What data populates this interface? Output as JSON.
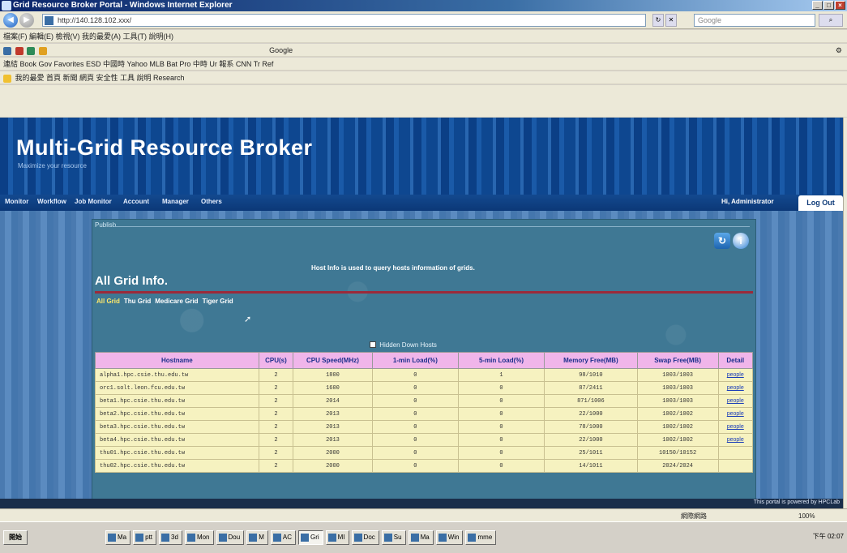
{
  "window": {
    "title": "Grid Resource Broker Portal - Windows Internet Explorer",
    "address": "http://140.128.102.xxx/",
    "search_placeholder": "Google"
  },
  "toolbars": {
    "menu_row": "檔案(F)  編輯(E)  檢視(V)  我的最愛(A)  工具(T)  說明(H)",
    "google_row": "Google",
    "links_row": "連結  Book  Gov  Favorites  ESD  中國時  Yahoo  MLB  Bat  Pro  中時  Ur  報系  CNN  Tr  Ref",
    "fav_row": "我的最愛  首頁  新聞  網頁  安全性  工具  說明  Research"
  },
  "header": {
    "title": "Multi-Grid Resource Broker",
    "subtitle": "Maximize your resource"
  },
  "nav": {
    "items": [
      "Monitor",
      "Workflow",
      "Job Monitor",
      "Account",
      "Manager",
      "Others"
    ],
    "greeting": "Hi, Administrator",
    "logout": "Log Out"
  },
  "panel": {
    "publish_label": "Publish",
    "host_info_note": "Host Info is used to query hosts information of grids.",
    "title": "All Grid Info.",
    "grid_tabs": [
      "All Grid",
      "Thu Grid",
      "Medicare Grid",
      "Tiger Grid"
    ],
    "hidden_nodes_label": "Hidden Down Hosts"
  },
  "table": {
    "columns": [
      "Hostname",
      "CPU(s)",
      "CPU Speed(MHz)",
      "1-min Load(%)",
      "5-min Load(%)",
      "Memory Free(MB)",
      "Swap Free(MB)",
      "Detail"
    ],
    "rows": [
      [
        "alpha1.hpc.csie.thu.edu.tw",
        "2",
        "1800",
        "0",
        "1",
        "98/1010",
        "1003/1003",
        "people"
      ],
      [
        "orc1.solt.leon.fcu.edu.tw",
        "2",
        "1600",
        "0",
        "0",
        "87/2411",
        "1003/1003",
        "people"
      ],
      [
        "beta1.hpc.csie.thu.edu.tw",
        "2",
        "2014",
        "0",
        "0",
        "871/1006",
        "1003/1003",
        "people"
      ],
      [
        "beta2.hpc.csie.thu.edu.tw",
        "2",
        "2013",
        "0",
        "0",
        "22/1000",
        "1002/1002",
        "people"
      ],
      [
        "beta3.hpc.csie.thu.edu.tw",
        "2",
        "2013",
        "0",
        "0",
        "78/1000",
        "1002/1002",
        "people"
      ],
      [
        "beta4.hpc.csie.thu.edu.tw",
        "2",
        "2013",
        "0",
        "0",
        "22/1000",
        "1002/1002",
        "people"
      ],
      [
        "thu01.hpc.csie.thu.edu.tw",
        "2",
        "2000",
        "0",
        "0",
        "25/1011",
        "10150/10152",
        ""
      ],
      [
        "thu02.hpc.csie.thu.edu.tw",
        "2",
        "2000",
        "0",
        "0",
        "14/1011",
        "2024/2024",
        ""
      ]
    ]
  },
  "footer": {
    "credit": "This portal is powered by HPCLab"
  },
  "statusbar": {
    "zone": "網際網路",
    "zoom": "100%"
  },
  "taskbar": {
    "start": "開始",
    "tasks": [
      "Ma",
      "ptt",
      "3d",
      "Mon",
      "Dou",
      "M",
      "AC",
      "Gri",
      "MI",
      "Doc",
      "Su",
      "Ma",
      "Win",
      "mme"
    ],
    "active_task": "Gri",
    "clock": "下午 02:07"
  },
  "colors": {
    "banner": "#0b3f86",
    "panel": "#3f7894",
    "table_header": "#f0b5ea",
    "table_row": "#f6f2c0",
    "title_rule": "#9b2a3a"
  }
}
